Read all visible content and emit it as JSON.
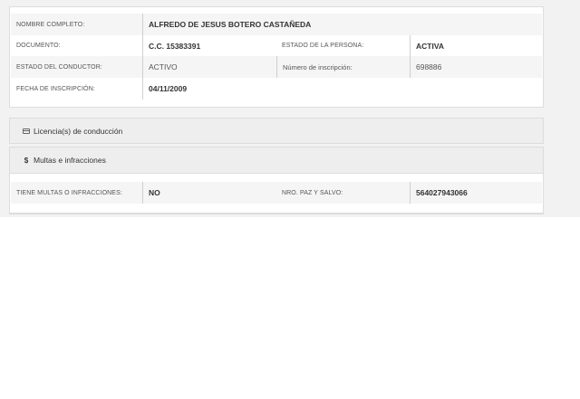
{
  "person": {
    "full_name_label": "NOMBRE COMPLETO:",
    "full_name": "ALFREDO DE JESUS BOTERO CASTAÑEDA",
    "document_label": "DOCUMENTO:",
    "document": "C.C. 15383391",
    "person_status_label": "ESTADO DE LA PERSONA:",
    "person_status": "ACTIVA",
    "driver_status_label": "ESTADO DEL CONDUCTOR:",
    "driver_status": "ACTIVO",
    "registration_number_label": "Número de inscripción:",
    "registration_number": "698886",
    "registration_date_label": "FECHA DE INSCRIPCIÓN:",
    "registration_date": "04/11/2009"
  },
  "sections": {
    "licenses": {
      "icon": "id-card-icon",
      "label": "Licencia(s) de conducción"
    },
    "fines": {
      "icon": "dollar-icon",
      "label": "Multas e infracciones"
    }
  },
  "fines": {
    "has_fines_label": "TIENE MULTAS O INFRACCIONES:",
    "has_fines": "NO",
    "clearance_label": "NRO. PAZ Y SALVO:",
    "clearance_number": "564027943066"
  }
}
